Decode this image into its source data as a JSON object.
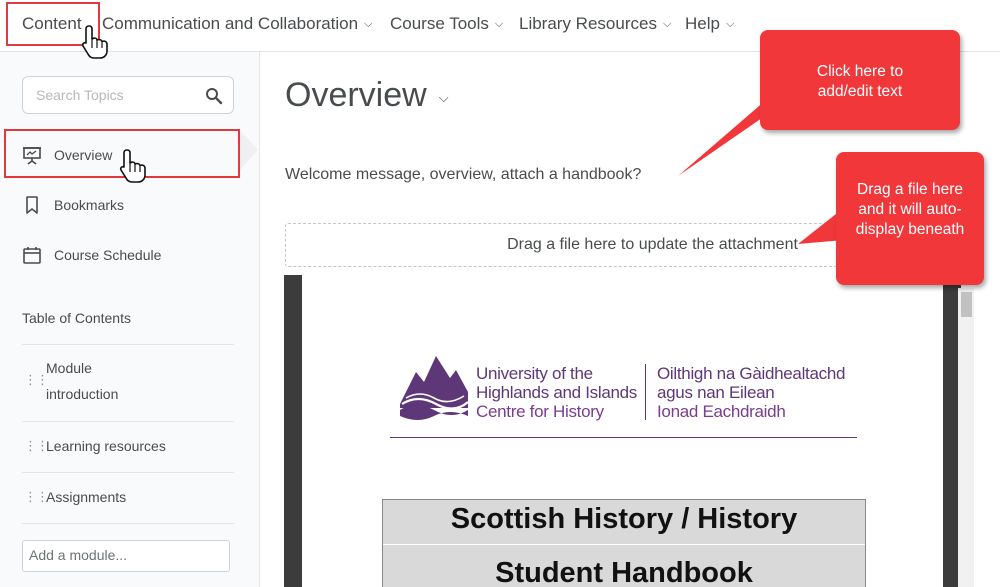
{
  "nav": {
    "items": [
      {
        "label": "Content",
        "chevron": false
      },
      {
        "label": "Communication and Collaboration",
        "chevron": true
      },
      {
        "label": "Course Tools",
        "chevron": true
      },
      {
        "label": "Library Resources",
        "chevron": true
      },
      {
        "label": "Help",
        "chevron": true
      }
    ]
  },
  "sidebar": {
    "search_placeholder": "Search Topics",
    "items": [
      {
        "label": "Overview",
        "icon": "presentation-icon"
      },
      {
        "label": "Bookmarks",
        "icon": "bookmark-icon"
      },
      {
        "label": "Course Schedule",
        "icon": "calendar-icon"
      }
    ],
    "toc_label": "Table of Contents",
    "modules": [
      {
        "line1": "Module",
        "line2": "introduction"
      },
      {
        "line1": "Learning resources"
      },
      {
        "line1": "Assignments"
      }
    ],
    "add_module_placeholder": "Add a module..."
  },
  "main": {
    "title": "Overview",
    "welcome": "Welcome message, overview, attach a handbook?",
    "dropzone": "Drag a file here to update the attachment"
  },
  "document": {
    "logo_en_line1": "University of the",
    "logo_en_line2": "Highlands and Islands",
    "logo_en_line3": "Centre for History",
    "logo_gd_line1": "Oilthigh na Gàidhealtachd",
    "logo_gd_line2": "agus nan Eilean",
    "logo_gd_line3": "Ionad Eachdraidh",
    "heading_line1": "Scottish History / History",
    "heading_line2": "Student Handbook"
  },
  "callouts": {
    "edit_text": "Click here to add/edit text",
    "drag_file": "Drag a file here and it will auto-display beneath"
  },
  "colors": {
    "highlight": "#e0393e",
    "callout": "#f2373b",
    "brand_purple": "#5e3778"
  }
}
